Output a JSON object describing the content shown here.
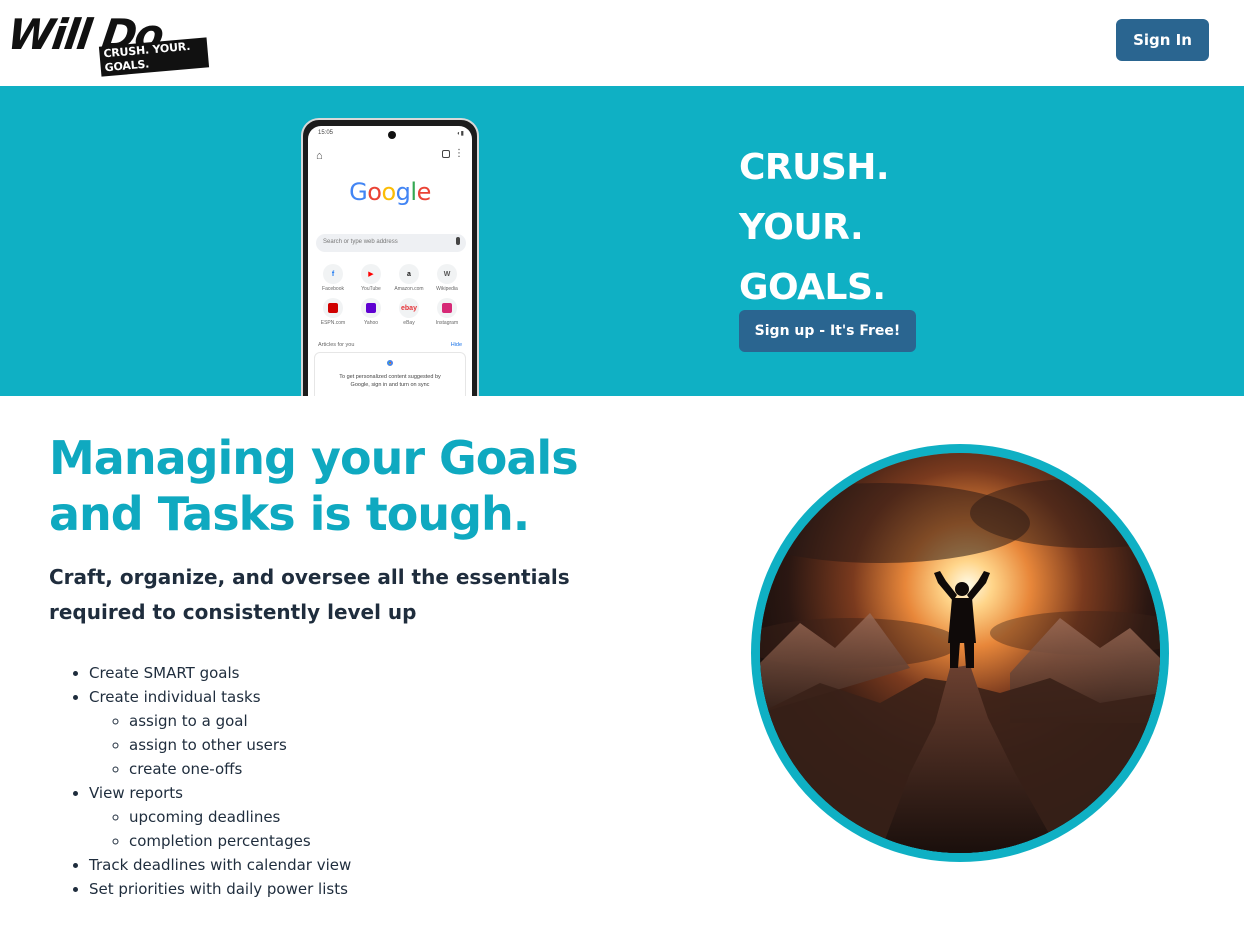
{
  "header": {
    "logo_main": "Will Do",
    "logo_tagline": "CRUSH. YOUR. GOALS.",
    "signin_label": "Sign In"
  },
  "hero": {
    "title_lines": [
      "CRUSH.",
      "YOUR.",
      "GOALS."
    ],
    "signup_label": "Sign up - It's Free!",
    "phone": {
      "status_time": "15:05",
      "search_placeholder": "Search or type web address",
      "shortcuts": [
        {
          "label": "Facebook",
          "icon": "facebook-icon",
          "glyph": "f",
          "color": "#1877f2"
        },
        {
          "label": "YouTube",
          "icon": "youtube-icon",
          "glyph": "▶",
          "color": "#ff0000"
        },
        {
          "label": "Amazon.com",
          "icon": "amazon-icon",
          "glyph": "a",
          "color": "#111111"
        },
        {
          "label": "Wikipedia",
          "icon": "wikipedia-icon",
          "glyph": "W",
          "color": "#555555"
        },
        {
          "label": "ESPN.com",
          "icon": "espn-icon",
          "glyph": "",
          "color": "#d00000"
        },
        {
          "label": "Yahoo",
          "icon": "yahoo-icon",
          "glyph": "",
          "color": "#5f01d1"
        },
        {
          "label": "eBay",
          "icon": "ebay-icon",
          "glyph": "ebay",
          "color": "#e53238"
        },
        {
          "label": "Instagram",
          "icon": "instagram-icon",
          "glyph": "",
          "color": "#d62976"
        }
      ],
      "articles_label": "Articles for you",
      "articles_hide": "Hide",
      "card_text": "To get personalized content suggested by Google, sign in and turn on sync"
    }
  },
  "main": {
    "heading": "Managing your Goals and Tasks is tough.",
    "subheading": "Craft, organize, and oversee all the essentials required to consistently level up",
    "features": [
      {
        "text": "Create SMART goals",
        "sub": []
      },
      {
        "text": "Create individual tasks",
        "sub": [
          "assign to a goal",
          "assign to other users",
          "create one-offs"
        ]
      },
      {
        "text": "View reports",
        "sub": [
          "upcoming deadlines",
          "completion percentages"
        ]
      },
      {
        "text": "Track deadlines with calendar view",
        "sub": []
      },
      {
        "text": "Set priorities with daily power lists",
        "sub": []
      }
    ]
  },
  "colors": {
    "accent_teal": "#0fb0c4",
    "button_blue": "#2a6590",
    "heading_teal": "#0fa9c0",
    "text_dark": "#1f2d3d"
  }
}
